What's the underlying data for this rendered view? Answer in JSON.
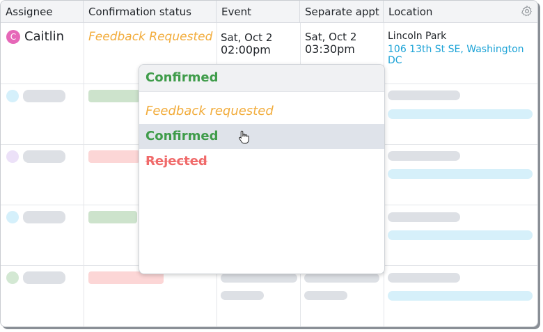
{
  "header": {
    "columns": [
      "Assignee",
      "Confirmation status",
      "Event",
      "Separate appt",
      "Location"
    ],
    "settings_icon": "gear-icon"
  },
  "row1": {
    "avatar_initial": "C",
    "assignee": "Caitlin",
    "status": "Feedback Requested",
    "event_date": "Sat, Oct 2",
    "event_time": "02:00pm",
    "appt_date": "Sat, Oct 2",
    "appt_time": "03:30pm",
    "location_name": "Lincoln Park",
    "location_address": "106 13th St SE, Washington DC"
  },
  "dropdown": {
    "selected": "Confirmed",
    "options": [
      "Feedback requested",
      "Confirmed",
      "Rejected"
    ],
    "hovered_option": "Confirmed"
  },
  "colors": {
    "feedback": "#f2ac3b",
    "confirmed": "#3f9c4a",
    "rejected": "#f06a6a",
    "link": "#1aa2d6",
    "avatar": "#e667b8"
  }
}
